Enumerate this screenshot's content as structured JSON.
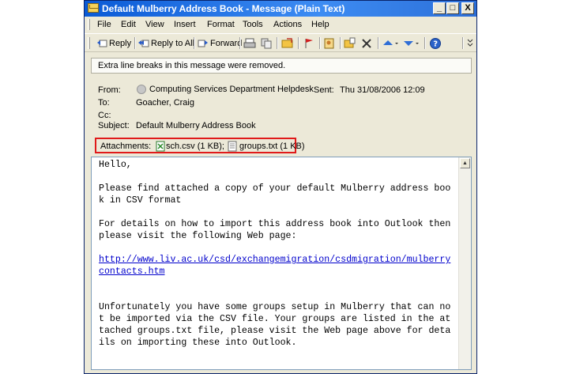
{
  "window": {
    "title": "Default Mulberry Address Book - Message (Plain Text)",
    "controls": {
      "minimize": "_",
      "restore": "□",
      "close": "X"
    }
  },
  "menu": [
    "File",
    "Edit",
    "View",
    "Insert",
    "Format",
    "Tools",
    "Actions",
    "Help"
  ],
  "toolbar": {
    "reply": "Reply",
    "reply_all": "Reply to All",
    "forward": "Forward"
  },
  "info_bar": "Extra line breaks in this message were removed.",
  "header": {
    "from_label": "From:",
    "from_value": "Computing Services Department Helpdesk",
    "sent_label": "Sent:",
    "sent_value": "Thu 31/08/2006 12:09",
    "to_label": "To:",
    "to_value": "Goacher, Craig",
    "cc_label": "Cc:",
    "cc_value": "",
    "subject_label": "Subject:",
    "subject_value": "Default Mulberry Address Book"
  },
  "attachments": {
    "label": "Attachments:",
    "files": [
      {
        "name": "sch.csv (1 KB);",
        "icon": "csv-file-icon"
      },
      {
        "name": "groups.txt (1 KB)",
        "icon": "text-file-icon"
      }
    ],
    "highlight_color": "#e01a1a"
  },
  "body": {
    "p1": "Hello,",
    "p2": "Please find attached a copy of your default Mulberry address book in CSV format",
    "p3": "For details on how to import this address book into Outlook then please visit the following Web page:",
    "link": "http://www.liv.ac.uk/csd/exchangemigration/csdmigration/mulberrycontacts.htm",
    "p4": "Unfortunately you have some groups setup in Mulberry that can not be imported via the CSV file. Your groups are listed in the attached groups.txt file, please visit the Web page above for details on importing these into Outlook."
  }
}
